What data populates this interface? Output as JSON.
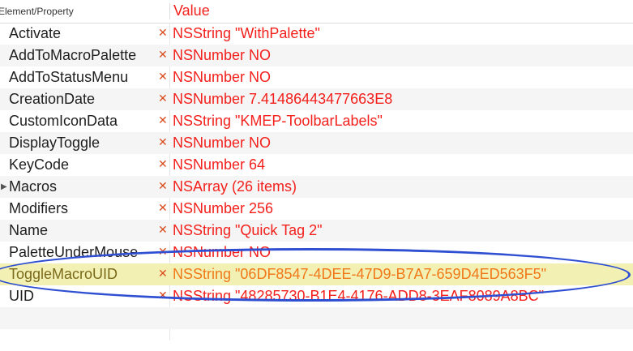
{
  "header": {
    "property_label": "Element/Property",
    "value_label": "Value"
  },
  "rows": [
    {
      "key": "Activate",
      "value": "NSString \"WithPalette\""
    },
    {
      "key": "AddToMacroPalette",
      "value": "NSNumber NO"
    },
    {
      "key": "AddToStatusMenu",
      "value": "NSNumber NO"
    },
    {
      "key": "CreationDate",
      "value": "NSNumber 7.41486443477663E8"
    },
    {
      "key": "CustomIconData",
      "value": "NSString \"KMEP-ToolbarLabels\""
    },
    {
      "key": "DisplayToggle",
      "value": "NSNumber NO"
    },
    {
      "key": "KeyCode",
      "value": "NSNumber 64"
    },
    {
      "key": "Macros",
      "value": "NSArray (26 items)",
      "disclosure": "▶"
    },
    {
      "key": "Modifiers",
      "value": "NSNumber 256"
    },
    {
      "key": "Name",
      "value": "NSString \"Quick Tag 2\""
    },
    {
      "key": "PaletteUnderMouse",
      "value": "NSNumber NO"
    },
    {
      "key": "ToggleMacroUID",
      "value": "NSString \"06DF8547-4DEE-47D9-B7A7-659D4ED563F5\"",
      "highlighted": true
    },
    {
      "key": "UID",
      "value": "NSString \"48285730-B1E4-4176-ADD8-3EAF8089A8BC\""
    }
  ],
  "icons": {
    "error": "✕"
  },
  "colors": {
    "value_text": "#f3201c",
    "highlight_row": "#f3f0b4",
    "highlight_value_text": "#f07818",
    "annotation_ellipse": "#2f4fd2",
    "error_icon": "#d94c1e"
  }
}
